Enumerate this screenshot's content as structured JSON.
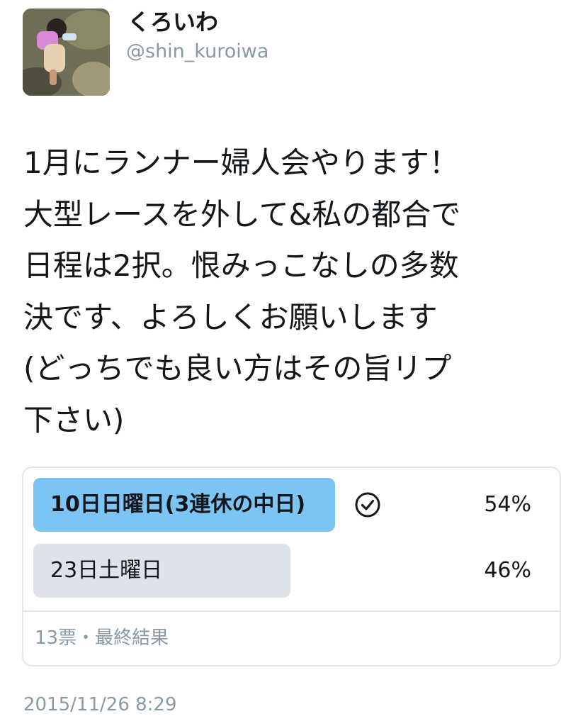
{
  "user": {
    "display_name": "くろいわ",
    "handle": "@shin_kuroiwa"
  },
  "tweet": {
    "lines": [
      "1月にランナー婦人会やります！",
      "大型レースを外して&私の都合で",
      "日程は2択。恨みっこなしの多数",
      "決です、よろしくお願いします",
      "(どっちでも良い方はその旨リプ",
      "下さい)"
    ]
  },
  "poll": {
    "options": [
      {
        "label": "10日日曜日(3連休の中日)",
        "percent_text": "54%",
        "percent": 54,
        "winner": true
      },
      {
        "label": "23日土曜日",
        "percent_text": "46%",
        "percent": 46,
        "winner": false
      }
    ],
    "meta": "13票・最終結果"
  },
  "timestamp": "2015/11/26 8:29",
  "colors": {
    "winner_bar": "#7cc4f3",
    "other_bar": "#dde3e8",
    "secondary_text": "#8899a6",
    "border": "#e1e8ed"
  },
  "icons": {
    "avatar": "profile-photo",
    "winner_mark": "check-circle-icon"
  }
}
